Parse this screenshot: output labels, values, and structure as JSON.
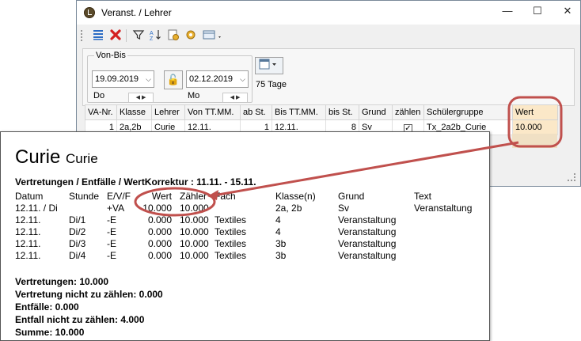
{
  "window": {
    "title": "Veranst. / Lehrer",
    "minimize_glyph": "—",
    "maximize_glyph": "☐",
    "close_glyph": "✕"
  },
  "toolbar": {
    "icons": [
      "list-icon",
      "delete-icon",
      "filter-icon",
      "sort-icon",
      "settings-icon",
      "gear-icon",
      "view-dropdown-icon"
    ]
  },
  "date_range": {
    "label": "Von-Bis",
    "from": "19.09.2019",
    "from_day": "Do",
    "to": "02.12.2019",
    "to_day": "Mo",
    "days": "75 Tage"
  },
  "grid": {
    "columns": [
      "VA-Nr.",
      "Klasse",
      "Lehrer",
      "Von TT.MM.",
      "ab St.",
      "Bis TT.MM.",
      "bis St.",
      "Grund",
      "zählen",
      "Schülergruppe",
      "Wert"
    ],
    "row": {
      "va_nr": "1",
      "klasse": "2a,2b",
      "lehrer": "Curie",
      "von": "12.11.",
      "ab_st": "1",
      "bis": "12.11.",
      "bis_st": "8",
      "grund": "Sv",
      "zaehlen": true,
      "schuelergruppe": "Tx_2a2b_Curie",
      "wert": "10.000"
    }
  },
  "report": {
    "name": "Curie",
    "name_sub": "Curie",
    "section_title": "Vertretungen / Entfälle / WertKorrektur : 11.11. - 15.11.",
    "headers": {
      "datum": "Datum",
      "stunde": "Stunde",
      "evf": "E/V/F",
      "wert": "Wert",
      "zaehler": "Zähler",
      "fach": "Fach",
      "klasse": "Klasse(n)",
      "grund": "Grund",
      "text": "Text"
    },
    "rows": [
      {
        "datum": "12.11. / Di",
        "stunde": "",
        "evf": "+VA",
        "wert": "10.000",
        "zaehler": "10.000",
        "fach": "",
        "klasse": "2a, 2b",
        "grund": "Sv",
        "text": "Veranstaltung"
      },
      {
        "datum": "12.11.",
        "stunde": "Di/1",
        "evf": "-E",
        "wert": "0.000",
        "zaehler": "10.000",
        "fach": "Textiles",
        "klasse": "4",
        "grund": "Veranstaltung",
        "text": ""
      },
      {
        "datum": "12.11.",
        "stunde": "Di/2",
        "evf": "-E",
        "wert": "0.000",
        "zaehler": "10.000",
        "fach": "Textiles",
        "klasse": "4",
        "grund": "Veranstaltung",
        "text": ""
      },
      {
        "datum": "12.11.",
        "stunde": "Di/3",
        "evf": "-E",
        "wert": "0.000",
        "zaehler": "10.000",
        "fach": "Textiles",
        "klasse": "3b",
        "grund": "Veranstaltung",
        "text": ""
      },
      {
        "datum": "12.11.",
        "stunde": "Di/4",
        "evf": "-E",
        "wert": "0.000",
        "zaehler": "10.000",
        "fach": "Textiles",
        "klasse": "3b",
        "grund": "Veranstaltung",
        "text": ""
      }
    ],
    "summary": [
      "Vertretungen: 10.000",
      "Vertretung nicht zu zählen: 0.000",
      "Entfälle: 0.000",
      "Entfall nicht zu zählen: 4.000",
      "Summe: 10.000"
    ]
  },
  "colors": {
    "highlight": "#c0504d",
    "wert_column": "#fbe8c8"
  }
}
